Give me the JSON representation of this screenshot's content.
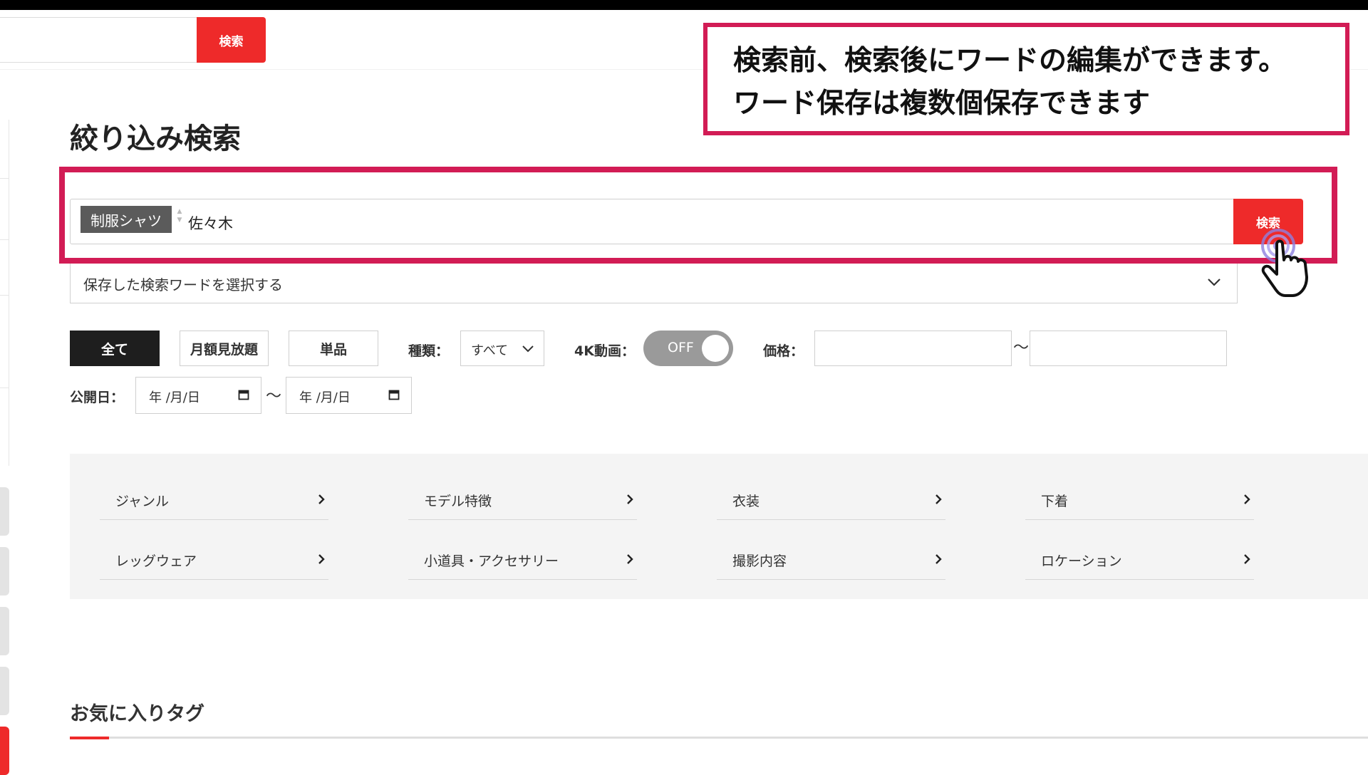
{
  "header": {
    "search_button": "検索"
  },
  "callout": {
    "line1": "検索前、検索後にワードの編集ができます。",
    "line2": "ワード保存は複数個保存できます"
  },
  "page_title": "絞り込み検索",
  "search": {
    "tag": "制服シャツ",
    "value": "佐々木",
    "button": "検索"
  },
  "saved_words": {
    "placeholder": "保存した検索ワードを選択する"
  },
  "filters": {
    "buttons": [
      "全て",
      "月額見放題",
      "単品"
    ],
    "kind_label": "種類：",
    "kind_value": "すべて",
    "k4_label": "4K動画：",
    "k4_toggle": "OFF",
    "price_label": "価格：",
    "range_sep": "〜",
    "date_label": "公開日：",
    "date_placeholder": "年 /月/日"
  },
  "categories": [
    "ジャンル",
    "モデル特徴",
    "衣装",
    "下着",
    "レッグウェア",
    "小道具・アクセサリー",
    "撮影内容",
    "ロケーション"
  ],
  "favorites": {
    "title": "お気に入りタグ"
  },
  "colors": {
    "accent": "#ee2a2a",
    "highlight": "#d21c55",
    "active_btn": "#1e1e1e"
  },
  "icons": [
    "chevron-down-icon",
    "chevron-right-icon",
    "calendar-icon",
    "pointer-hand-icon"
  ]
}
